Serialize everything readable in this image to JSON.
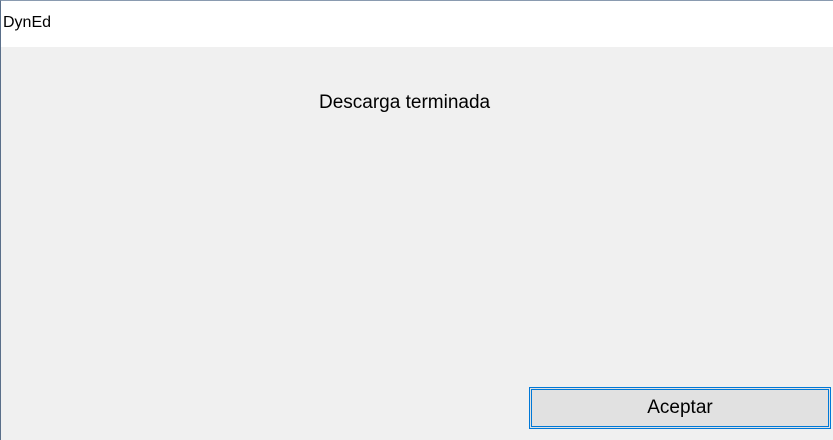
{
  "window": {
    "title": "DynEd"
  },
  "message": {
    "text": "Descarga terminada"
  },
  "buttons": {
    "ok_label": "Aceptar"
  },
  "colors": {
    "dialog_background": "#f0f0f0",
    "title_background": "#ffffff",
    "button_background": "#e1e1e1",
    "focus_border": "#0078d7"
  }
}
